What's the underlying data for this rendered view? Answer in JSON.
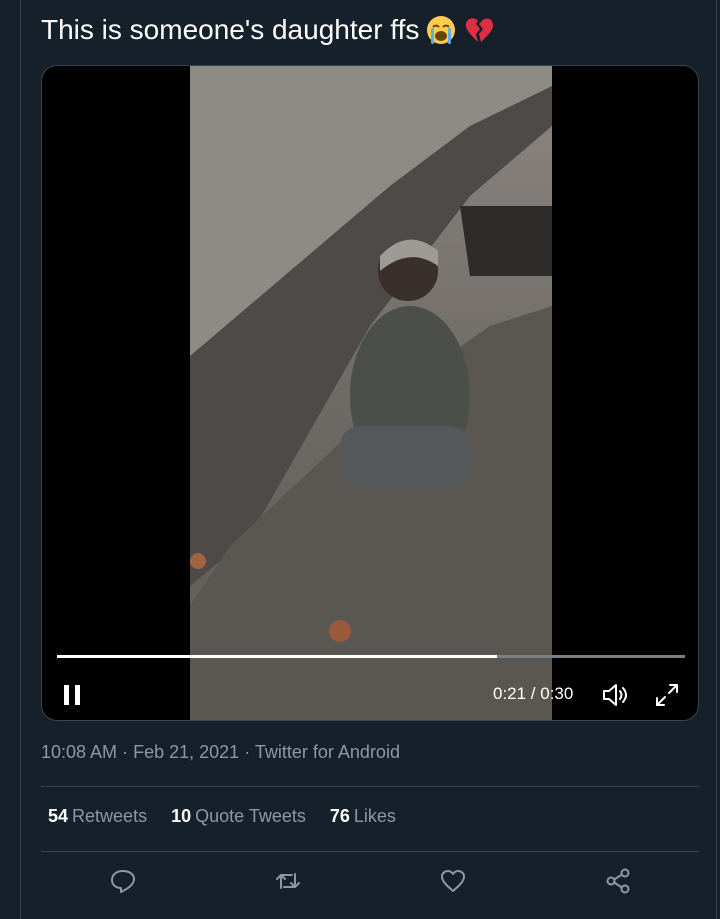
{
  "tweet": {
    "text": "This is someone's daughter ffs",
    "emojis": [
      "loudly-crying-face-emoji",
      "broken-heart-emoji"
    ]
  },
  "video": {
    "elapsed": "0:21",
    "duration": "0:30",
    "time_display": "0:21 / 0:30",
    "progress_fraction": 0.7,
    "pause_icon": "pause-icon",
    "volume_icon": "volume-icon",
    "fullscreen_icon": "fullscreen-icon"
  },
  "meta": {
    "time": "10:08 AM",
    "date": "Feb 21, 2021",
    "source": "Twitter for Android",
    "separator": "·"
  },
  "stats": {
    "retweets_count": "54",
    "retweets_label": "Retweets",
    "quotes_count": "10",
    "quotes_label": "Quote Tweets",
    "likes_count": "76",
    "likes_label": "Likes"
  },
  "actions": [
    "reply-icon",
    "retweet-icon",
    "like-icon",
    "share-icon"
  ],
  "colors": {
    "background": "#15202b",
    "border": "#38444d",
    "secondary_text": "#8b98a5",
    "primary_text": "#ffffff"
  }
}
